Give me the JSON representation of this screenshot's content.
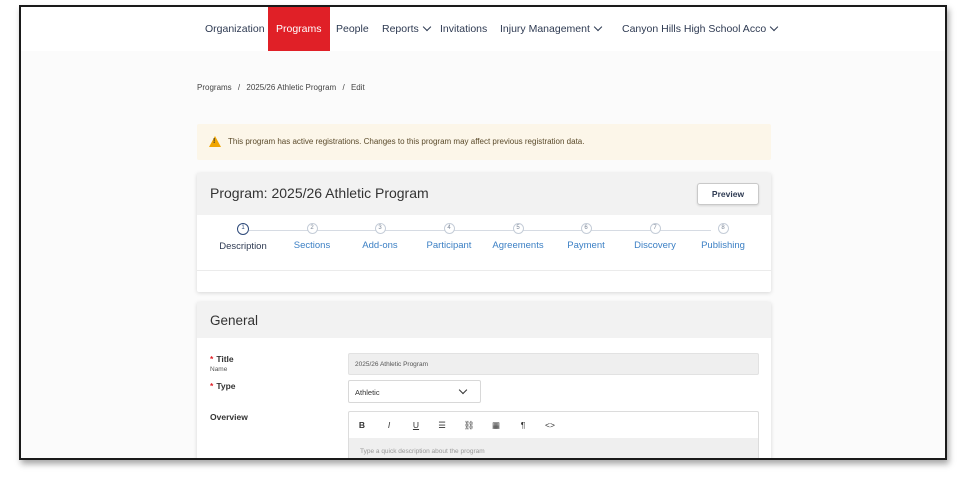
{
  "nav": {
    "items": [
      "Organization",
      "Programs",
      "People",
      "Reports",
      "Invitations",
      "Injury Management",
      "Canyon Hills High School Acco"
    ],
    "active": "Programs"
  },
  "breadcrumb": [
    "Programs",
    "/",
    "2025/26 Athletic Program",
    "/",
    "Edit"
  ],
  "alert": {
    "icon": "warning-icon",
    "text": "This program has active registrations. Changes to this program may affect previous registration data."
  },
  "program": {
    "title": "Program: 2025/26 Athletic Program",
    "preview_label": "Preview"
  },
  "steps": [
    {
      "num": "1",
      "label": "Description",
      "active": true
    },
    {
      "num": "2",
      "label": "Sections"
    },
    {
      "num": "3",
      "label": "Add-ons"
    },
    {
      "num": "4",
      "label": "Participant"
    },
    {
      "num": "5",
      "label": "Agreements"
    },
    {
      "num": "6",
      "label": "Payment"
    },
    {
      "num": "7",
      "label": "Discovery"
    },
    {
      "num": "8",
      "label": "Publishing"
    }
  ],
  "general": {
    "heading": "General",
    "title_label": "Title",
    "title_sub": "Name",
    "title_value": "2025/26 Athletic Program",
    "type_label": "Type",
    "type_value": "Athletic",
    "overview_label": "Overview",
    "required_mark": "*",
    "toolbar": [
      "B",
      "I",
      "U",
      "☰",
      "⛓",
      "▦",
      "¶",
      "<>"
    ],
    "overview_placeholder": "Type a quick description about the program"
  },
  "colors": {
    "accent": "#e02027",
    "link": "#3b7fc4",
    "alert_bg": "#fcf6e9",
    "warning": "#f0a500"
  }
}
